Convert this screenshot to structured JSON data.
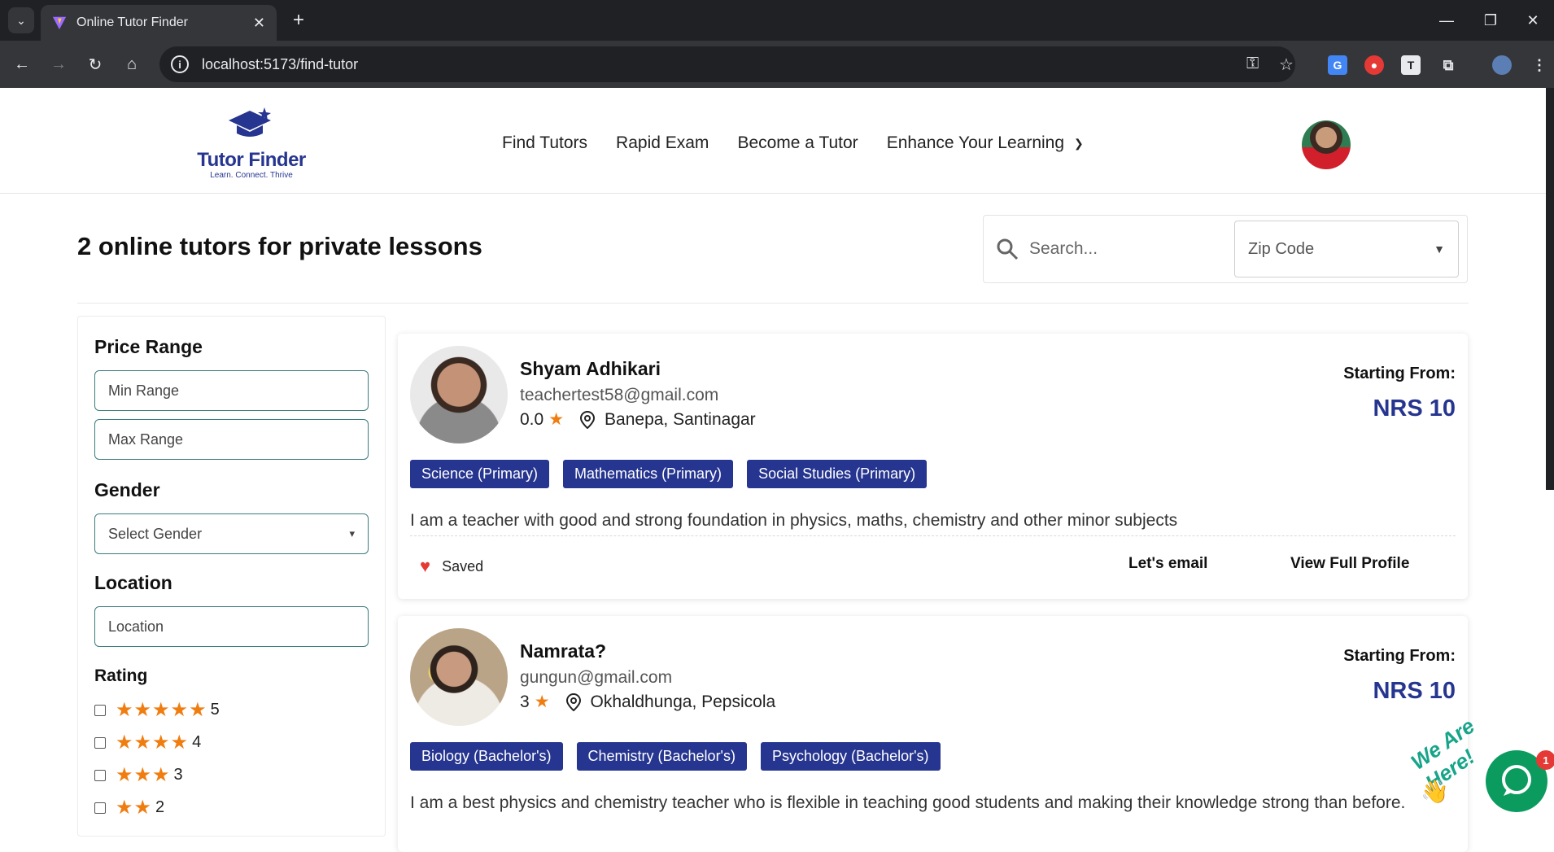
{
  "browser": {
    "tab_title": "Online Tutor Finder",
    "url": "localhost:5173/find-tutor"
  },
  "site": {
    "brand": "Tutor Finder",
    "tagline": "Learn. Connect. Thrive",
    "nav": [
      "Find Tutors",
      "Rapid Exam",
      "Become a Tutor",
      "Enhance Your Learning"
    ]
  },
  "page": {
    "title": "2 online tutors for private lessons",
    "search_placeholder": "Search...",
    "zip_placeholder": "Zip Code"
  },
  "filters": {
    "price_heading": "Price Range",
    "min_placeholder": "Min Range",
    "max_placeholder": "Max Range",
    "gender_heading": "Gender",
    "gender_placeholder": "Select Gender",
    "location_heading": "Location",
    "location_placeholder": "Location",
    "rating_heading": "Rating",
    "ratings": [
      "5",
      "4",
      "3",
      "2"
    ]
  },
  "tutors": [
    {
      "name": "Shyam Adhikari",
      "email": "teachertest58@gmail.com",
      "rating": "0.0",
      "location": "Banepa, Santinagar",
      "starting_from": "Starting From:",
      "price": "NRS 10",
      "subjects": [
        "Science (Primary)",
        "Mathematics (Primary)",
        "Social Studies (Primary)"
      ],
      "bio": "I am a teacher with good and strong foundation in physics, maths, chemistry and other minor subjects",
      "saved_label": "Saved",
      "email_action": "Let's email",
      "profile_action": "View Full Profile"
    },
    {
      "name": "Namrata?",
      "email": "gungun@gmail.com",
      "rating": "3",
      "location": "Okhaldhunga, Pepsicola",
      "starting_from": "Starting From:",
      "price": "NRS 10",
      "subjects": [
        "Biology (Bachelor's)",
        "Chemistry (Bachelor's)",
        "Psychology (Bachelor's)"
      ],
      "bio": "I am a best physics and chemistry teacher who is flexible in teaching good students and making their knowledge strong than before."
    }
  ],
  "chat": {
    "label": "We Are Here!",
    "badge": "1"
  },
  "colors": {
    "brand": "#26358f",
    "star": "#f07d10",
    "chat": "#0b9b5f"
  }
}
